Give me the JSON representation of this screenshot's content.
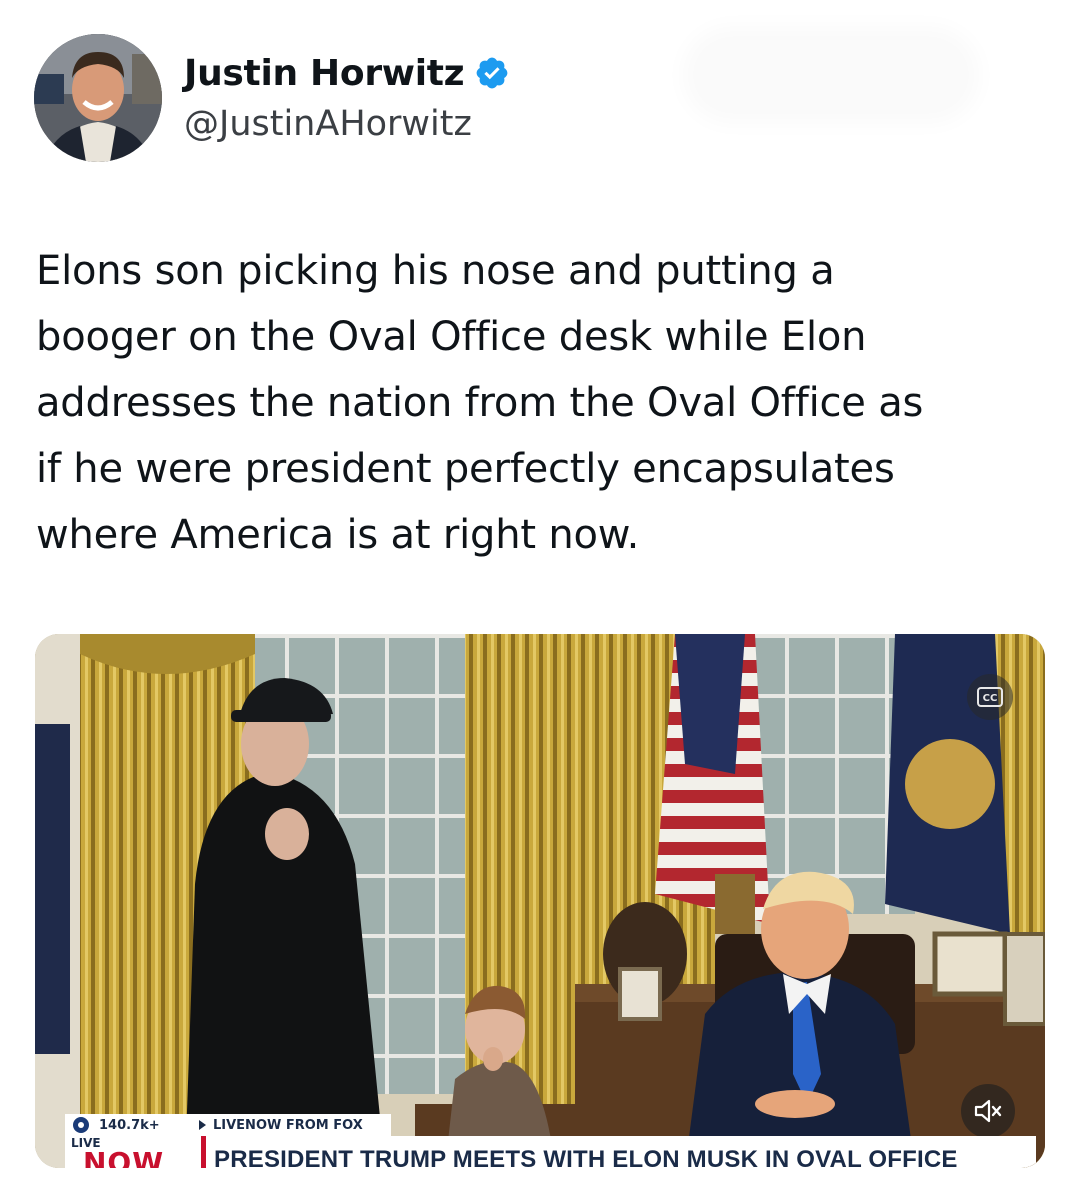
{
  "author": {
    "display_name": "Justin Horwitz",
    "handle": "@JustinAHorwitz",
    "verified": true,
    "avatar_icon": "profile-photo"
  },
  "tweet": {
    "text": "Elons son picking his nose and putting a\nbooger on the Oval Office desk while Elon\naddresses the nation from the Oval Office as\nif he were president perfectly encapsulates\nwhere America is at right now."
  },
  "media": {
    "type": "video",
    "views": "140.7k+",
    "source": "LIVENOW FROM FOX",
    "live_label": "LIVE",
    "now_label": "NOW",
    "headline": "PRESIDENT TRUMP MEETS WITH ELON MUSK IN OVAL OFFICE",
    "cc_icon": "closed-captions-icon",
    "mute_icon": "speaker-muted-icon"
  },
  "colors": {
    "verified_blue": "#1d9bf0",
    "text_primary": "#0f1419",
    "handle_gray": "#536471",
    "news_red": "#c8102e",
    "news_navy": "#1a2b48"
  }
}
